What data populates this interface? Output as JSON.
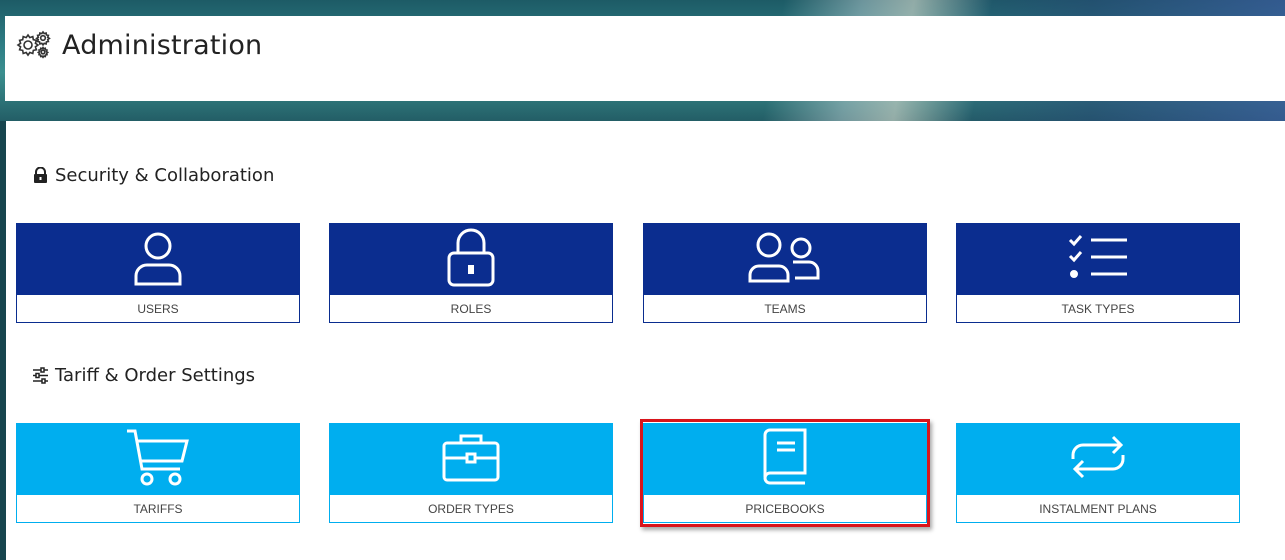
{
  "header": {
    "title": "Administration",
    "icon": "gears-icon"
  },
  "sections": [
    {
      "title": "Security & Collaboration",
      "icon": "lock-icon",
      "tiles": [
        {
          "label": "USERS",
          "icon": "user-icon"
        },
        {
          "label": "ROLES",
          "icon": "padlock-icon"
        },
        {
          "label": "TEAMS",
          "icon": "team-icon"
        },
        {
          "label": "TASK TYPES",
          "icon": "checklist-icon"
        }
      ]
    },
    {
      "title": "Tariff & Order Settings",
      "icon": "sliders-icon",
      "tiles": [
        {
          "label": "TARIFFS",
          "icon": "cart-icon"
        },
        {
          "label": "ORDER TYPES",
          "icon": "briefcase-icon"
        },
        {
          "label": "PRICEBOOKS",
          "icon": "book-icon"
        },
        {
          "label": "INSTALMENT PLANS",
          "icon": "repeat-icon"
        }
      ]
    }
  ],
  "colors": {
    "dark_tile": "#0b2d8f",
    "light_tile": "#00aeef",
    "highlight": "#d9141b"
  }
}
